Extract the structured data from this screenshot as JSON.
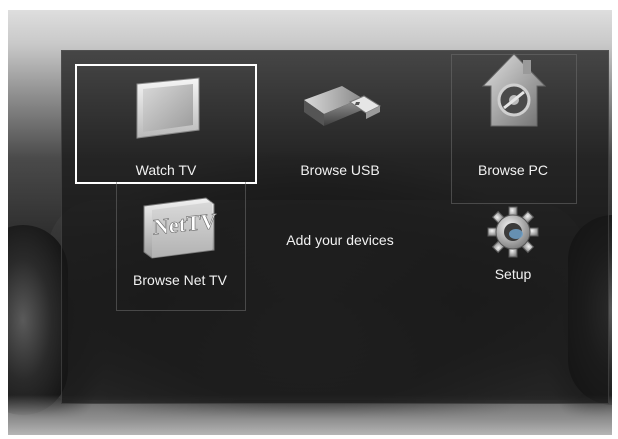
{
  "menu": {
    "items": [
      {
        "label": "Watch TV",
        "icon": "tv-icon",
        "selected": true
      },
      {
        "label": "Browse USB",
        "icon": "usb-drive-icon",
        "selected": false
      },
      {
        "label": "Browse PC",
        "icon": "home-network-icon",
        "selected": false
      },
      {
        "label": "Browse Net TV",
        "icon": "net-tv-icon",
        "selected": false
      },
      {
        "label": "Setup",
        "icon": "gear-icon",
        "selected": false
      }
    ],
    "add_devices_label": "Add your devices",
    "net_tv_logo_text": "NetTV"
  },
  "colors": {
    "selection_border": "#ffffff",
    "panel_background": "#161616",
    "label_text": "#f2f2f2"
  }
}
